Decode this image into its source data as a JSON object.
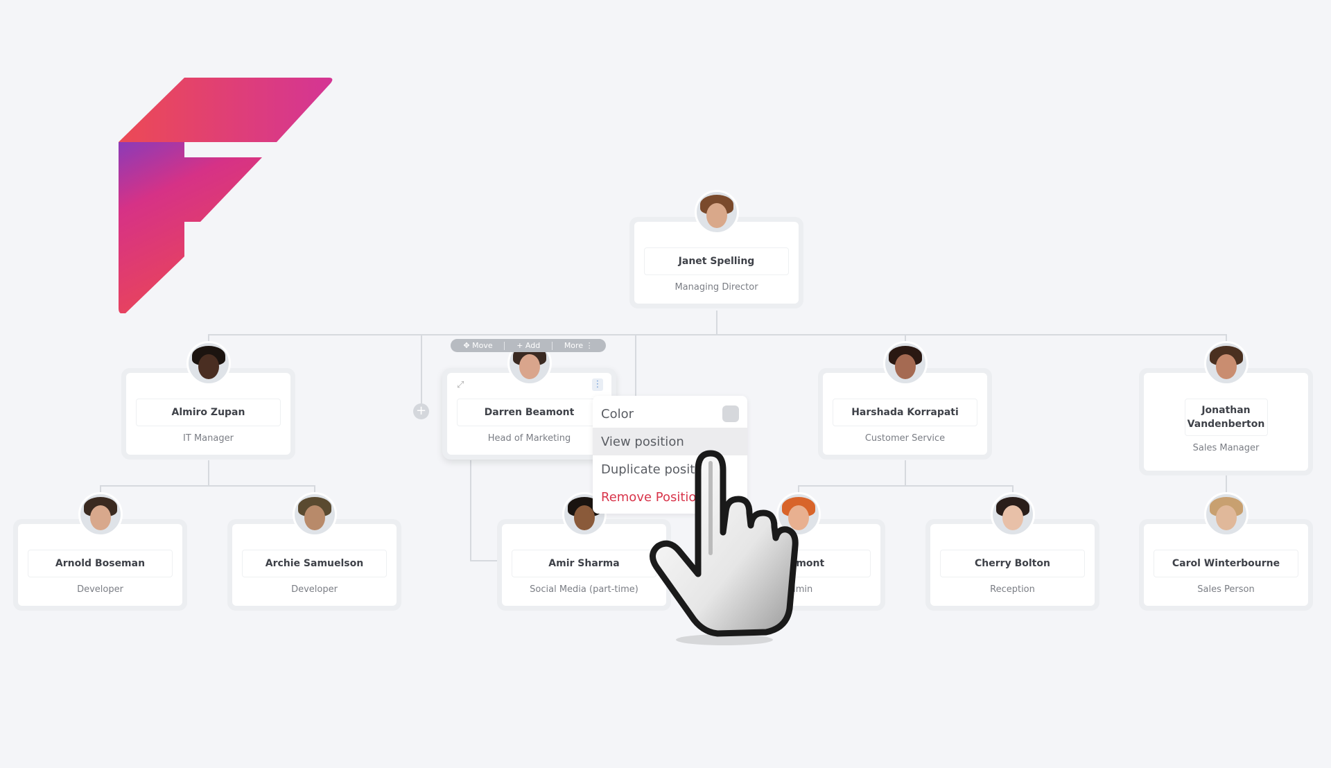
{
  "logo": {
    "letter": "F",
    "colors": {
      "top": "#e8445a",
      "mid": "#d6337f",
      "accent": "#8a3ab9"
    }
  },
  "toolbar": {
    "move": "Move",
    "add": "Add",
    "more": "More"
  },
  "context_menu": {
    "items": [
      {
        "label": "Color",
        "state": "normal"
      },
      {
        "label": "View position",
        "state": "hover"
      },
      {
        "label": "Duplicate position",
        "state": "normal"
      },
      {
        "label": "Remove Position",
        "state": "danger"
      }
    ],
    "color_swatch": "#d6d8dc"
  },
  "nodes": [
    {
      "id": "janet",
      "name": "Janet Spelling",
      "title": "Managing Director",
      "skin": "#d9a88a",
      "hair": "#7a4a2c"
    },
    {
      "id": "almiro",
      "name": "Almiro Zupan",
      "title": "IT Manager",
      "skin": "#4a2e22",
      "hair": "#1c1410"
    },
    {
      "id": "darren",
      "name": "Darren Beamont",
      "title": "Head of Marketing",
      "skin": "#d9a58c",
      "hair": "#3a2a22",
      "selected": true
    },
    {
      "id": "harshada",
      "name": "Harshada Korrapati",
      "title": "Customer Service",
      "skin": "#a56a52",
      "hair": "#2a1812"
    },
    {
      "id": "jonathan",
      "name": "Jonathan Vandenberton",
      "title": "Sales Manager",
      "skin": "#c98d70",
      "hair": "#4a3020"
    },
    {
      "id": "arnold",
      "name": "Arnold Boseman",
      "title": "Developer",
      "skin": "#d8a88c",
      "hair": "#3a2a20"
    },
    {
      "id": "archie",
      "name": "Archie Samuelson",
      "title": "Developer",
      "skin": "#b88a6a",
      "hair": "#5a4a30"
    },
    {
      "id": "amir",
      "name": "Amir Sharma",
      "title": "Social Media (part-time)",
      "skin": "#8a5a3a",
      "hair": "#1a1410"
    },
    {
      "id": "freemont",
      "name": "Freemont",
      "title": "Admin",
      "skin": "#e8b090",
      "hair": "#d8642a"
    },
    {
      "id": "cherry",
      "name": "Cherry Bolton",
      "title": "Reception",
      "skin": "#e8c0a8",
      "hair": "#2a1e1a"
    },
    {
      "id": "carol",
      "name": "Carol Winterbourne",
      "title": "Sales Person",
      "skin": "#e0b89a",
      "hair": "#c8a070"
    }
  ]
}
